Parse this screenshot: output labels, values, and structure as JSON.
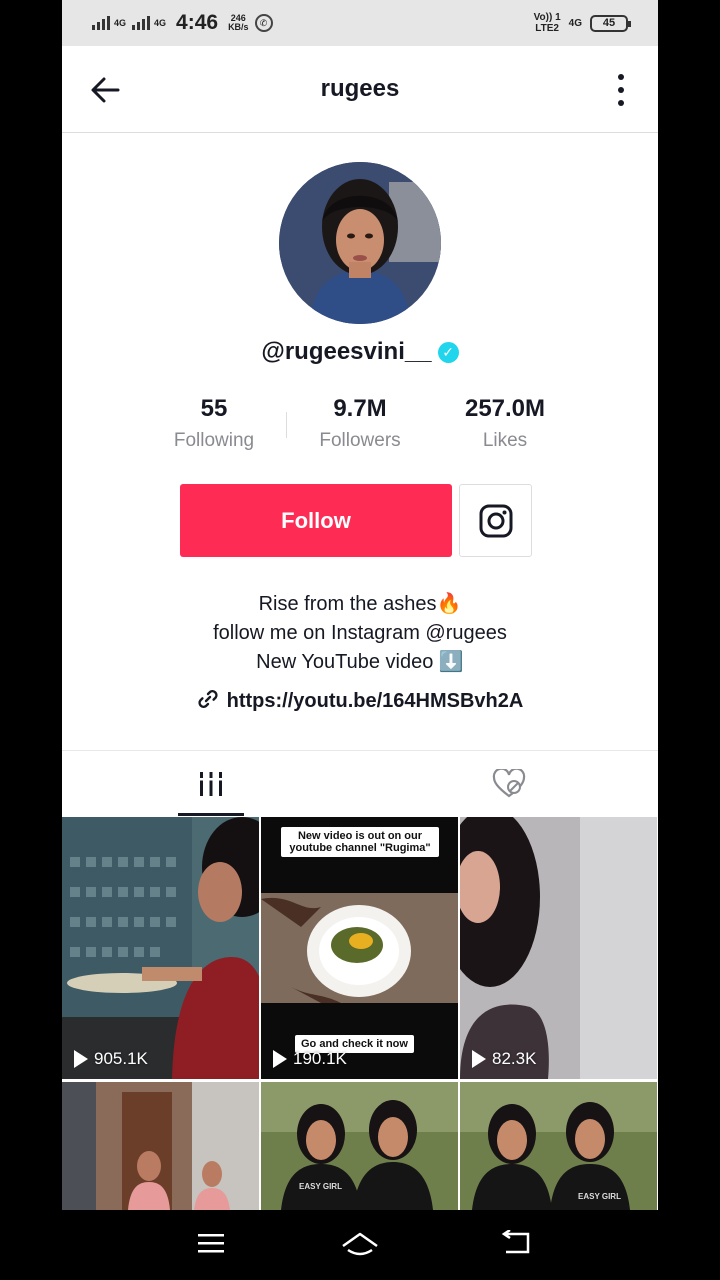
{
  "status_bar": {
    "net1": "4G",
    "net2": "4G",
    "time": "4:46",
    "speed_top": "246",
    "speed_bottom": "KB/s",
    "volte_top": "Vo)) 1",
    "volte_bottom": "LTE2",
    "net3": "4G",
    "battery": "45"
  },
  "header": {
    "title": "rugees"
  },
  "profile": {
    "username": "@rugeesvini__",
    "following_count": "55",
    "following_label": "Following",
    "followers_count": "9.7M",
    "followers_label": "Followers",
    "likes_count": "257.0M",
    "likes_label": "Likes",
    "follow_label": "Follow",
    "bio": [
      "Rise from the ashes🔥",
      "follow me on Instagram @rugees",
      "New YouTube video ⬇️"
    ],
    "link": "https://youtu.be/164HMSBvh2A"
  },
  "videos": [
    {
      "views": "905.1K"
    },
    {
      "views": "190.1K",
      "caption_top": "New video is out on our youtube channel \"Rugima\"",
      "caption_bottom": "Go and check it now"
    },
    {
      "views": "82.3K"
    },
    {
      "views": ""
    },
    {
      "views": "",
      "shirt_text": "EASY GIRL"
    },
    {
      "views": "",
      "shirt_text": "EASY GIRL"
    }
  ],
  "colors": {
    "accent": "#fe2c55",
    "verified": "#20d5ec",
    "text": "#161823",
    "muted": "#8a8b91"
  }
}
